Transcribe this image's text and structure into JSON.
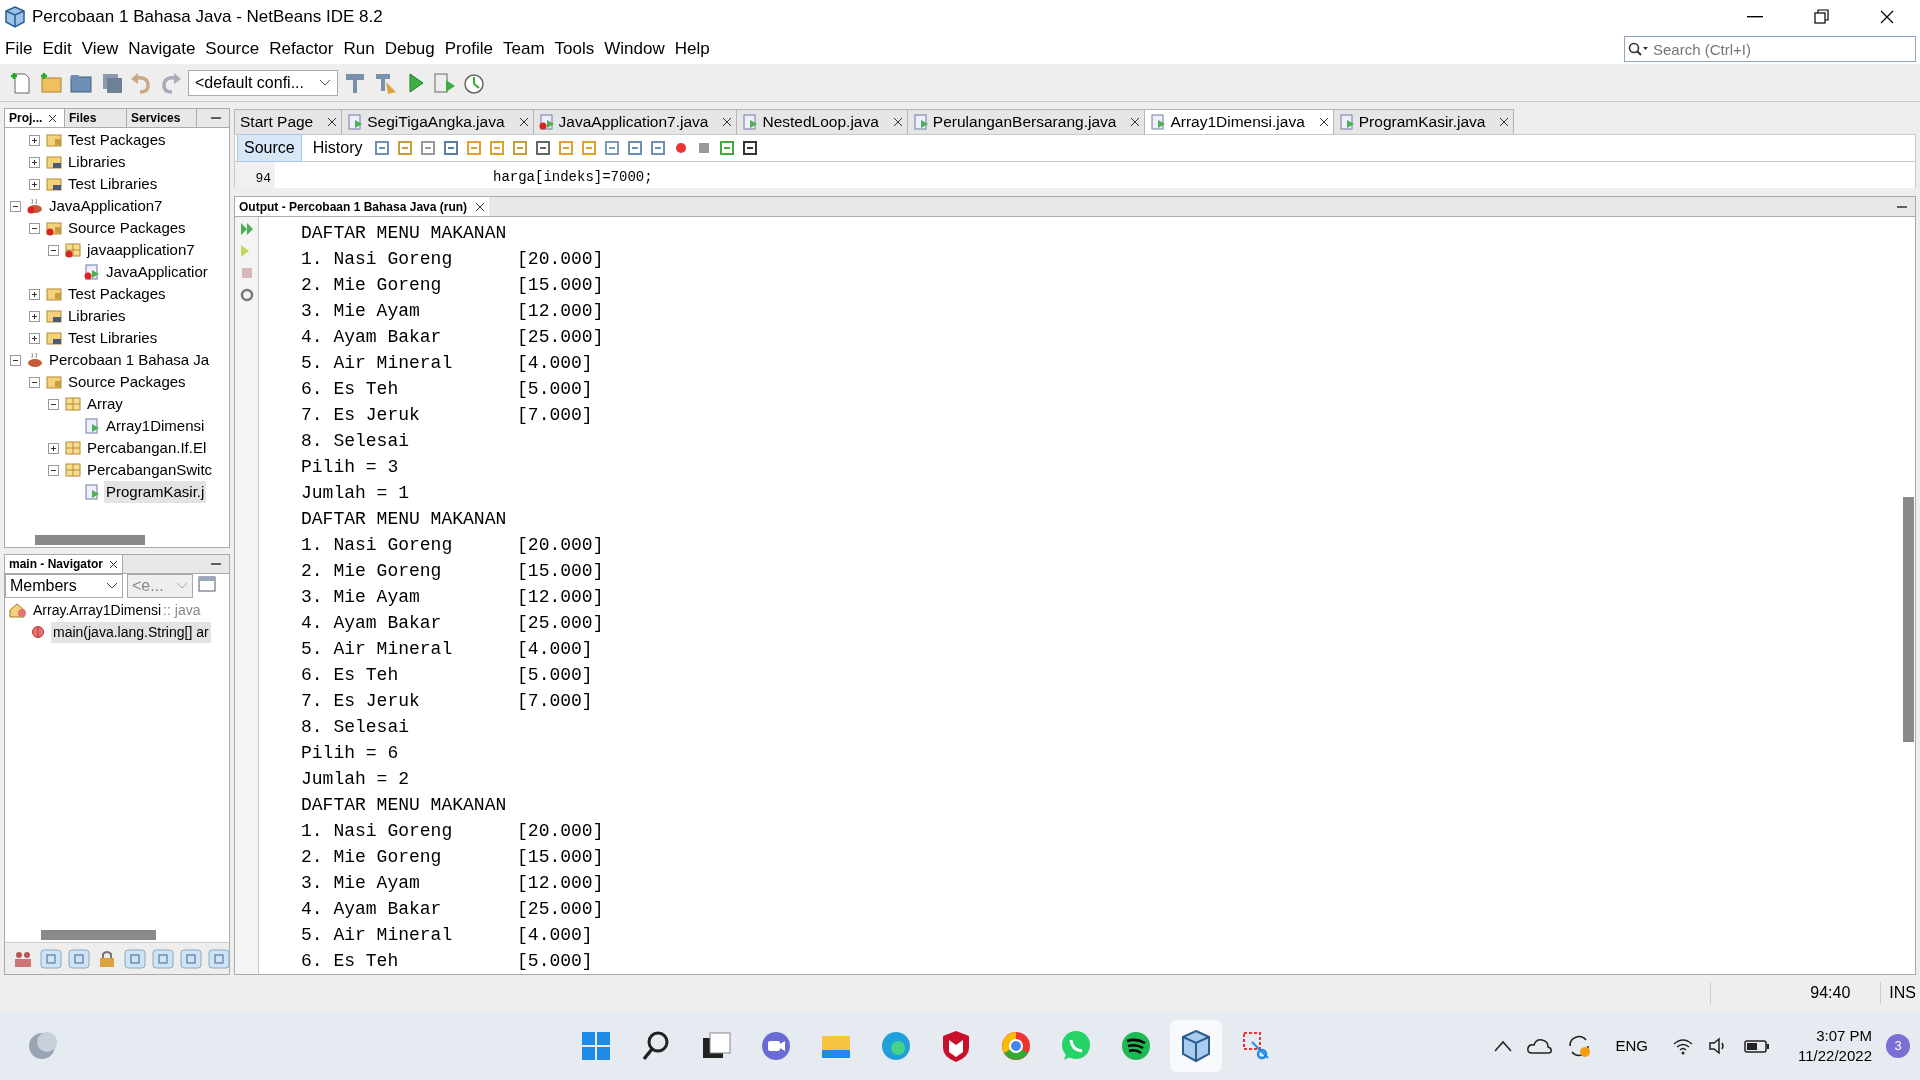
{
  "window": {
    "title": "Percobaan 1 Bahasa Java - NetBeans IDE 8.2"
  },
  "menu": [
    "File",
    "Edit",
    "View",
    "Navigate",
    "Source",
    "Refactor",
    "Run",
    "Debug",
    "Profile",
    "Team",
    "Tools",
    "Window",
    "Help"
  ],
  "search": {
    "placeholder": "Search (Ctrl+I)"
  },
  "toolbar": {
    "configuration": "<default confi..."
  },
  "projects_panel": {
    "tabs": [
      {
        "label": "Proj...",
        "selected": true
      },
      {
        "label": "Files",
        "selected": false
      },
      {
        "label": "Services",
        "selected": false
      }
    ],
    "tree": [
      {
        "children": [
          {
            "label": "Test Packages",
            "kind": "folder",
            "expanded": false,
            "selected": false
          },
          {
            "label": "Libraries",
            "kind": "library",
            "expanded": false,
            "selected": false
          },
          {
            "label": "Test Libraries",
            "kind": "library",
            "expanded": false,
            "selected": false
          }
        ]
      },
      {
        "label": "JavaApplication7",
        "kind": "project",
        "expanded": true,
        "selected": false,
        "error": true,
        "children": [
          {
            "label": "Source Packages",
            "kind": "folder",
            "expanded": true,
            "selected": false,
            "error": true,
            "children": [
              {
                "label": "javaapplication7",
                "kind": "package",
                "expanded": true,
                "selected": false,
                "error": true,
                "children": [
                  {
                    "label": "JavaApplicatior",
                    "kind": "file",
                    "selected": false,
                    "error": true
                  }
                ]
              }
            ]
          },
          {
            "label": "Test Packages",
            "kind": "folder",
            "expanded": false,
            "selected": false
          },
          {
            "label": "Libraries",
            "kind": "library",
            "expanded": false,
            "selected": false
          },
          {
            "label": "Test Libraries",
            "kind": "library",
            "expanded": false,
            "selected": false
          }
        ]
      },
      {
        "label": "Percobaan 1 Bahasa Ja",
        "kind": "project",
        "expanded": true,
        "selected": false,
        "children": [
          {
            "label": "Source Packages",
            "kind": "folder",
            "expanded": true,
            "selected": false,
            "children": [
              {
                "label": "Array",
                "kind": "package",
                "expanded": true,
                "selected": false,
                "children": [
                  {
                    "label": "Array1Dimensi",
                    "kind": "file",
                    "selected": false
                  }
                ]
              },
              {
                "label": "Percabangan.If.El",
                "kind": "package",
                "expanded": false,
                "selected": false
              },
              {
                "label": "PercabanganSwitc",
                "kind": "package",
                "expanded": true,
                "selected": false,
                "children": [
                  {
                    "label": "ProgramKasir.j",
                    "kind": "file",
                    "selected": true
                  }
                ]
              }
            ]
          }
        ]
      }
    ]
  },
  "navigator": {
    "title": "main - Navigator",
    "view": "Members",
    "filter": "<e...",
    "items": [
      {
        "label": "Array.Array1Dimensi",
        "suffix": ":: java",
        "selected": false,
        "children": [
          {
            "label": "main(java.lang.String[] ar",
            "selected": true
          }
        ]
      }
    ]
  },
  "editor": {
    "tabs": [
      {
        "label": "Start Page",
        "kind": "page",
        "selected": false
      },
      {
        "label": "SegiTigaAngka.java",
        "kind": "java",
        "selected": false
      },
      {
        "label": "JavaApplication7.java",
        "kind": "java-error",
        "selected": false
      },
      {
        "label": "NestedLoop.java",
        "kind": "java",
        "selected": false
      },
      {
        "label": "PerulanganBersarang.java",
        "kind": "java",
        "selected": false
      },
      {
        "label": "Array1Dimensi.java",
        "kind": "java",
        "selected": true
      },
      {
        "label": "ProgramKasir.java",
        "kind": "java",
        "selected": false
      }
    ],
    "views": [
      {
        "label": "Source",
        "selected": true
      },
      {
        "label": "History",
        "selected": false
      }
    ],
    "code_line": {
      "number": "94",
      "text": "harga[indeks]=7000;"
    }
  },
  "output": {
    "title": "Output - Percobaan 1 Bahasa Java (run)",
    "lines": [
      "DAFTAR MENU MAKANAN",
      "1. Nasi Goreng      [20.000]",
      "2. Mie Goreng       [15.000]",
      "3. Mie Ayam         [12.000]",
      "4. Ayam Bakar       [25.000]",
      "5. Air Mineral      [4.000]",
      "6. Es Teh           [5.000]",
      "7. Es Jeruk         [7.000]",
      "8. Selesai",
      "Pilih = 3",
      "Jumlah = 1",
      "DAFTAR MENU MAKANAN",
      "1. Nasi Goreng      [20.000]",
      "2. Mie Goreng       [15.000]",
      "3. Mie Ayam         [12.000]",
      "4. Ayam Bakar       [25.000]",
      "5. Air Mineral      [4.000]",
      "6. Es Teh           [5.000]",
      "7. Es Jeruk         [7.000]",
      "8. Selesai",
      "Pilih = 6",
      "Jumlah = 2",
      "DAFTAR MENU MAKANAN",
      "1. Nasi Goreng      [20.000]",
      "2. Mie Goreng       [15.000]",
      "3. Mie Ayam         [12.000]",
      "4. Ayam Bakar       [25.000]",
      "5. Air Mineral      [4.000]",
      "6. Es Teh           [5.000]"
    ]
  },
  "status_bar": {
    "position": "94:40",
    "mode": "INS"
  },
  "taskbar": {
    "time": "3:07 PM",
    "date": "11/22/2022",
    "language": "ENG",
    "notifications": "3"
  }
}
